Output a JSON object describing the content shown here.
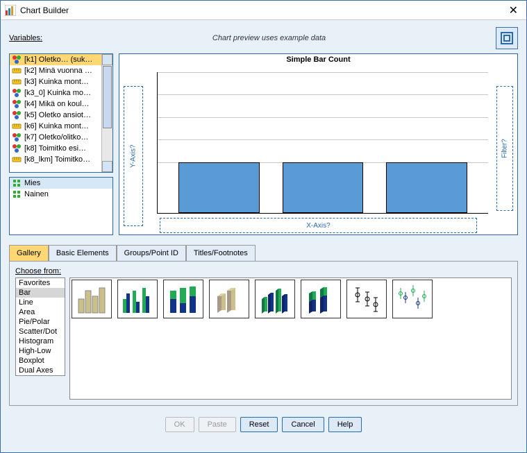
{
  "window": {
    "title": "Chart Builder"
  },
  "header": {
    "variables_label": "Variables:",
    "preview_note": "Chart preview uses example data"
  },
  "variables": [
    {
      "icon": "nominal",
      "label": "[k1] Oletko… (suk…",
      "selected": true
    },
    {
      "icon": "scale",
      "label": "[k2] Minä vuonna …"
    },
    {
      "icon": "scale",
      "label": "[k3] Kuinka mont…"
    },
    {
      "icon": "nominal",
      "label": "[k3_0] Kuinka mo…"
    },
    {
      "icon": "nominal",
      "label": "[k4] Mikä on koul…"
    },
    {
      "icon": "nominal",
      "label": "[k5] Oletko ansiot…"
    },
    {
      "icon": "scale",
      "label": "[k6] Kuinka mont…"
    },
    {
      "icon": "nominal",
      "label": "[k7] Oletko/olitko…"
    },
    {
      "icon": "nominal",
      "label": "[k8] Toimitko esi…"
    },
    {
      "icon": "scale",
      "label": "[k8_lkm] Toimitko…"
    }
  ],
  "values": [
    {
      "label": "Mies",
      "selected": true
    },
    {
      "label": "Nainen"
    }
  ],
  "chart_preview": {
    "title": "Simple Bar Count",
    "yaxis_hint": "Y-Axis?",
    "xaxis_hint": "X-Axis?",
    "filter_hint": "Filter?"
  },
  "chart_data": {
    "type": "bar",
    "categories": [
      "",
      "",
      ""
    ],
    "values": [
      36,
      36,
      36
    ],
    "title": "Simple Bar Count",
    "xlabel": "X-Axis?",
    "ylabel": "Y-Axis?",
    "ylim": [
      0,
      100
    ]
  },
  "tabs": {
    "gallery": "Gallery",
    "basic": "Basic Elements",
    "groups": "Groups/Point ID",
    "titles": "Titles/Footnotes",
    "active": "gallery"
  },
  "gallery": {
    "choose_label": "Choose from:",
    "types": [
      "Favorites",
      "Bar",
      "Line",
      "Area",
      "Pie/Polar",
      "Scatter/Dot",
      "Histogram",
      "High-Low",
      "Boxplot",
      "Dual Axes"
    ],
    "selected_type": "Bar",
    "thumbs": [
      "simple-bar",
      "clustered-bar",
      "stacked-bar",
      "3d-bar",
      "3d-clustered",
      "3d-stacked",
      "error-bar",
      "clustered-error-bar"
    ]
  },
  "buttons": {
    "ok": "OK",
    "paste": "Paste",
    "reset": "Reset",
    "cancel": "Cancel",
    "help": "Help"
  }
}
